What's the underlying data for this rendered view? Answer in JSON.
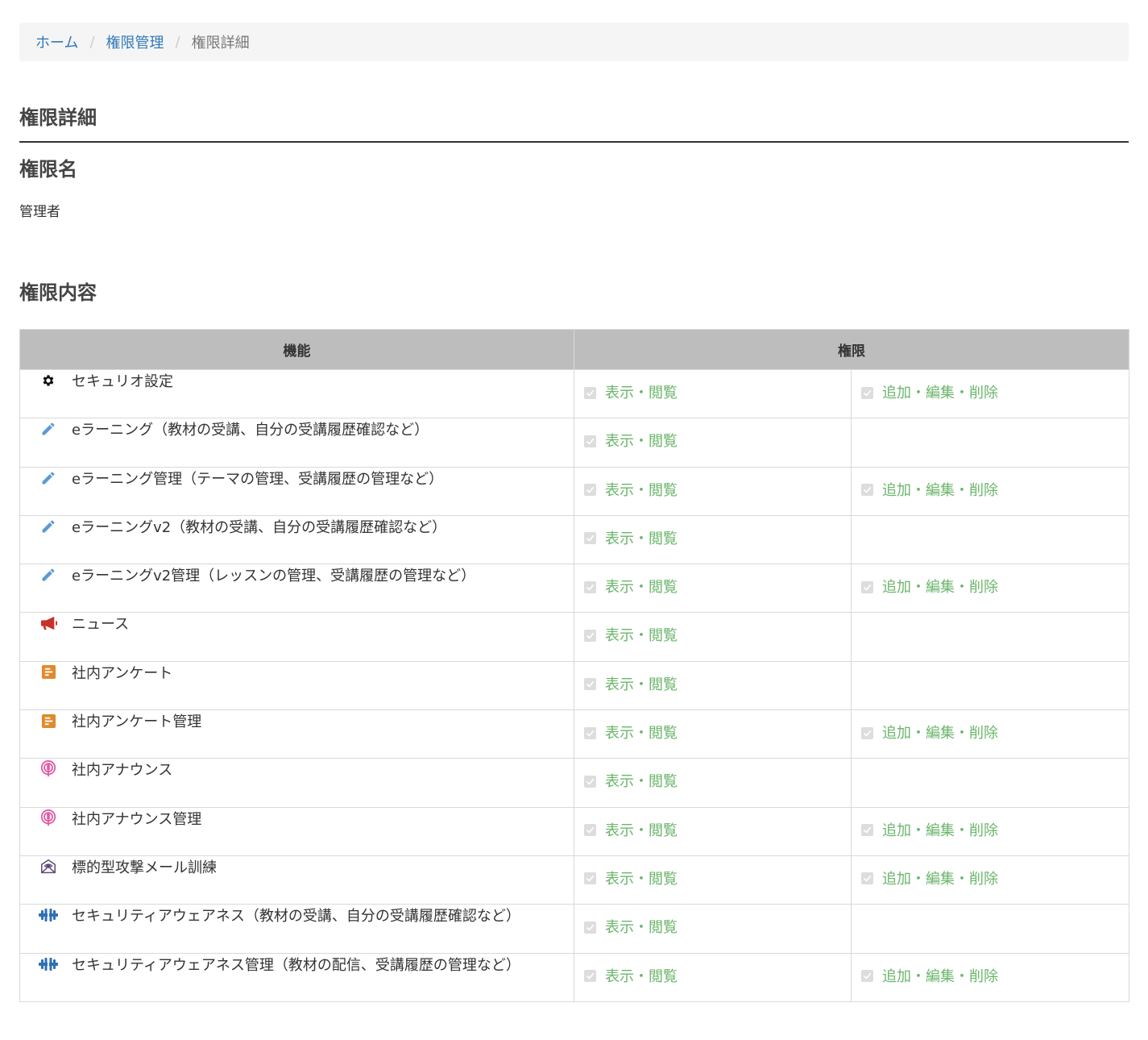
{
  "breadcrumb": {
    "home": "ホーム",
    "manage": "権限管理",
    "current": "権限詳細",
    "separator": "/"
  },
  "page": {
    "title": "権限詳細",
    "role_name_heading": "権限名",
    "role_name": "管理者",
    "content_heading": "権限内容"
  },
  "table": {
    "headers": {
      "feature": "機能",
      "permission": "権限"
    },
    "rows": [
      {
        "icon": "gear-icon",
        "icon_color": "#111111",
        "feature": "セキュリオ設定",
        "view": "表示・閲覧",
        "edit": "追加・編集・削除"
      },
      {
        "icon": "pencil-icon",
        "icon_color": "#5b9bd5",
        "feature": "eラーニング（教材の受講、自分の受講履歴確認など）",
        "view": "表示・閲覧",
        "edit": ""
      },
      {
        "icon": "pencil-icon",
        "icon_color": "#5b9bd5",
        "feature": "eラーニング管理（テーマの管理、受講履歴の管理など）",
        "view": "表示・閲覧",
        "edit": "追加・編集・削除"
      },
      {
        "icon": "pencil-icon",
        "icon_color": "#5b9bd5",
        "feature": "eラーニングv2（教材の受講、自分の受講履歴確認など）",
        "view": "表示・閲覧",
        "edit": ""
      },
      {
        "icon": "pencil-icon",
        "icon_color": "#5b9bd5",
        "feature": "eラーニングv2管理（レッスンの管理、受講履歴の管理など）",
        "view": "表示・閲覧",
        "edit": "追加・編集・削除"
      },
      {
        "icon": "megaphone-icon",
        "icon_color": "#c9302c",
        "feature": "ニュース",
        "view": "表示・閲覧",
        "edit": ""
      },
      {
        "icon": "survey-icon",
        "icon_color": "#e08a2c",
        "feature": "社内アンケート",
        "view": "表示・閲覧",
        "edit": ""
      },
      {
        "icon": "survey-icon",
        "icon_color": "#e08a2c",
        "feature": "社内アンケート管理",
        "view": "表示・閲覧",
        "edit": "追加・編集・削除"
      },
      {
        "icon": "podcast-icon",
        "icon_color": "#e05ca6",
        "feature": "社内アナウンス",
        "view": "表示・閲覧",
        "edit": ""
      },
      {
        "icon": "podcast-icon",
        "icon_color": "#e05ca6",
        "feature": "社内アナウンス管理",
        "view": "表示・閲覧",
        "edit": "追加・編集・削除"
      },
      {
        "icon": "phishing-mail-icon",
        "icon_color": "#5c4a7a",
        "feature": "標的型攻撃メール訓練",
        "view": "表示・閲覧",
        "edit": "追加・編集・削除"
      },
      {
        "icon": "dumbbell-icon",
        "icon_color": "#2f6fb5",
        "feature": "セキュリティアウェアネス（教材の受講、自分の受講履歴確認など）",
        "view": "表示・閲覧",
        "edit": ""
      },
      {
        "icon": "dumbbell-icon",
        "icon_color": "#2f6fb5",
        "feature": "セキュリティアウェアネス管理（教材の配信、受講履歴の管理など）",
        "view": "表示・閲覧",
        "edit": "追加・編集・削除"
      }
    ]
  }
}
